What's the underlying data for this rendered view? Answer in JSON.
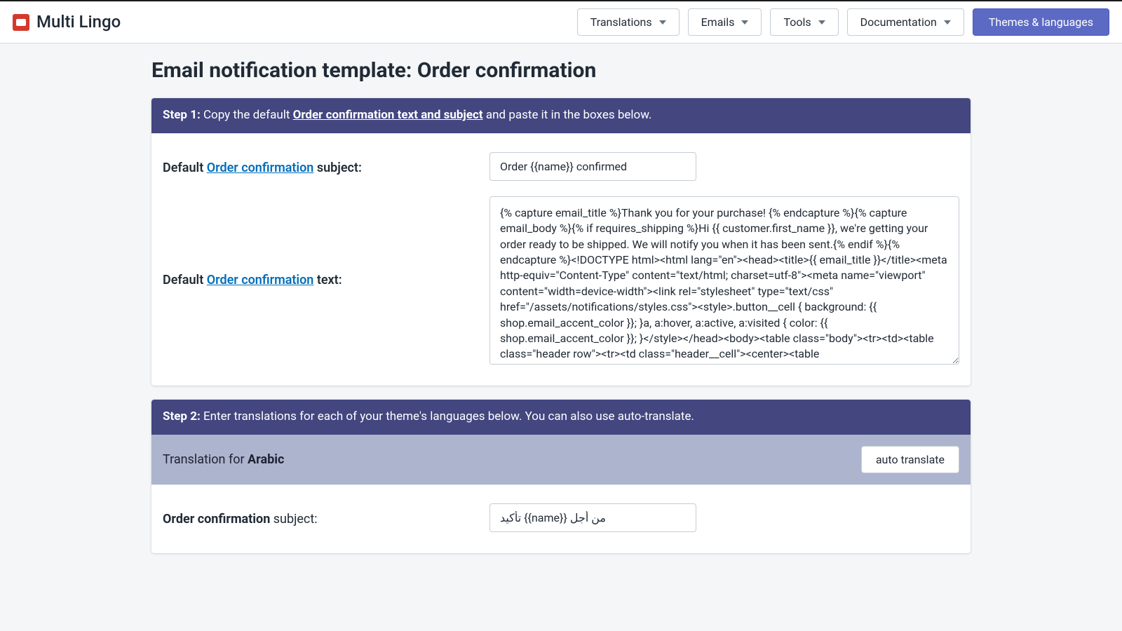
{
  "brand": {
    "name": "Multi Lingo"
  },
  "nav": {
    "translations": "Translations",
    "emails": "Emails",
    "tools": "Tools",
    "documentation": "Documentation",
    "themes": "Themes & languages"
  },
  "page": {
    "title": "Email notification template: Order confirmation"
  },
  "step1": {
    "label": "Step 1:",
    "prefix": " Copy the default ",
    "link_text": "Order confirmation text and subject",
    "suffix": " and paste it in the boxes below."
  },
  "defaults": {
    "subject_label_prefix": "Default ",
    "subject_label_link": "Order confirmation",
    "subject_label_suffix": " subject:",
    "subject_value": "Order {{name}} confirmed",
    "text_label_prefix": "Default ",
    "text_label_link": "Order confirmation",
    "text_label_suffix": " text:",
    "text_value": "{% capture email_title %}Thank you for your purchase! {% endcapture %}{% capture email_body %}{% if requires_shipping %}Hi {{ customer.first_name }}, we're getting your order ready to be shipped. We will notify you when it has been sent.{% endif %}{% endcapture %}<!DOCTYPE html><html lang=\"en\"><head><title>{{ email_title }}</title><meta http-equiv=\"Content-Type\" content=\"text/html; charset=utf-8\"><meta name=\"viewport\" content=\"width=device-width\"><link rel=\"stylesheet\" type=\"text/css\" href=\"/assets/notifications/styles.css\"><style>.button__cell { background: {{ shop.email_accent_color }}; }a, a:hover, a:active, a:visited { color: {{ shop.email_accent_color }}; }</style></head><body><table class=\"body\"><tr><td><table class=\"header row\"><tr><td class=\"header__cell\"><center><table"
  },
  "step2": {
    "label": "Step 2:",
    "text": " Enter translations for each of your theme's languages below. You can also use auto-translate."
  },
  "translation": {
    "prefix": "Translation for ",
    "language": "Arabic",
    "auto_translate": "auto translate",
    "subject_label_link": "Order confirmation",
    "subject_label_suffix": " subject:",
    "subject_value": "تأكيد {{name}} من أجل"
  }
}
